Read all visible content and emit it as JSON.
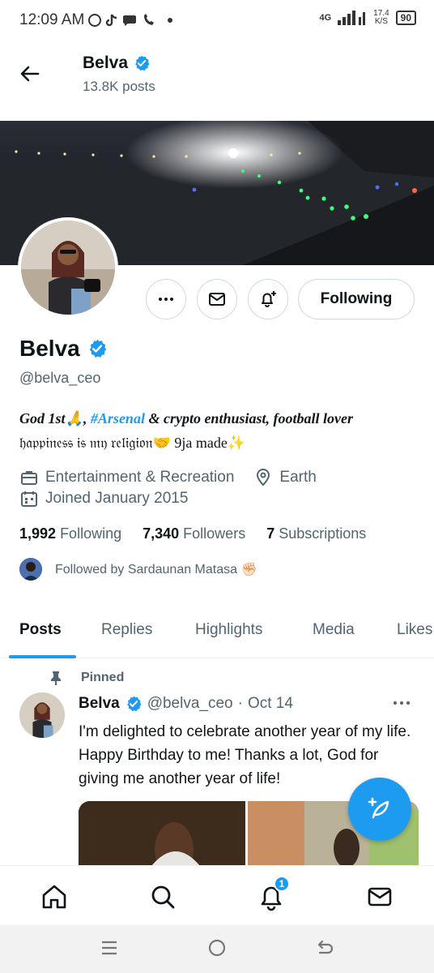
{
  "status_bar": {
    "time": "12:09 AM",
    "left_icons": [
      "whatsapp-icon",
      "tiktok-icon",
      "chat-icon",
      "phone-icon",
      "dot-icon"
    ],
    "network": "4G",
    "speed": "17.4",
    "speed_unit": "K/S",
    "battery": "90"
  },
  "header": {
    "name": "Belva",
    "posts": "13.8K posts"
  },
  "profile": {
    "name": "Belva",
    "handle": "@belva_ceo",
    "follow_label": "Following",
    "bio_line1_a": "God 1st🙏, ",
    "bio_line1_link": "#Arsenal",
    "bio_line1_b": " & crypto enthusiast, football lover",
    "bio_line2": "𝔥𝔞𝔭𝔭𝔦𝔫𝔢𝔰𝔰 𝔦𝔰 𝔪𝔶 𝔯𝔢𝔩𝔦𝔤𝔦𝔬𝔫🤝 9ja made✨",
    "category": "Entertainment & Recreation",
    "location": "Earth",
    "joined": "Joined January 2015",
    "following_count": "1,992",
    "following_label": "Following",
    "followers_count": "7,340",
    "followers_label": "Followers",
    "subscriptions_count": "7",
    "subscriptions_label": "Subscriptions",
    "followed_by": "Followed by Sardaunan Matasa ✊🏻"
  },
  "tabs": [
    {
      "label": "Posts",
      "active": true
    },
    {
      "label": "Replies"
    },
    {
      "label": "Highlights"
    },
    {
      "label": "Media"
    },
    {
      "label": "Likes"
    }
  ],
  "pinned_tweet": {
    "pinned_label": "Pinned",
    "name": "Belva",
    "handle": "@belva_ceo",
    "separator": "·",
    "date": "Oct 14",
    "text": "I'm delighted to celebrate another year of my life. Happy Birthday to me! Thanks a lot, God for giving me another year of life!"
  },
  "bottom_nav": {
    "items": [
      "home-icon",
      "search-icon",
      "notifications-icon",
      "messages-icon"
    ],
    "notification_badge": "1"
  },
  "colors": {
    "accent": "#1d9bf0",
    "text": "#0f1419",
    "secondary": "#536471",
    "border": "#cfd9de"
  }
}
